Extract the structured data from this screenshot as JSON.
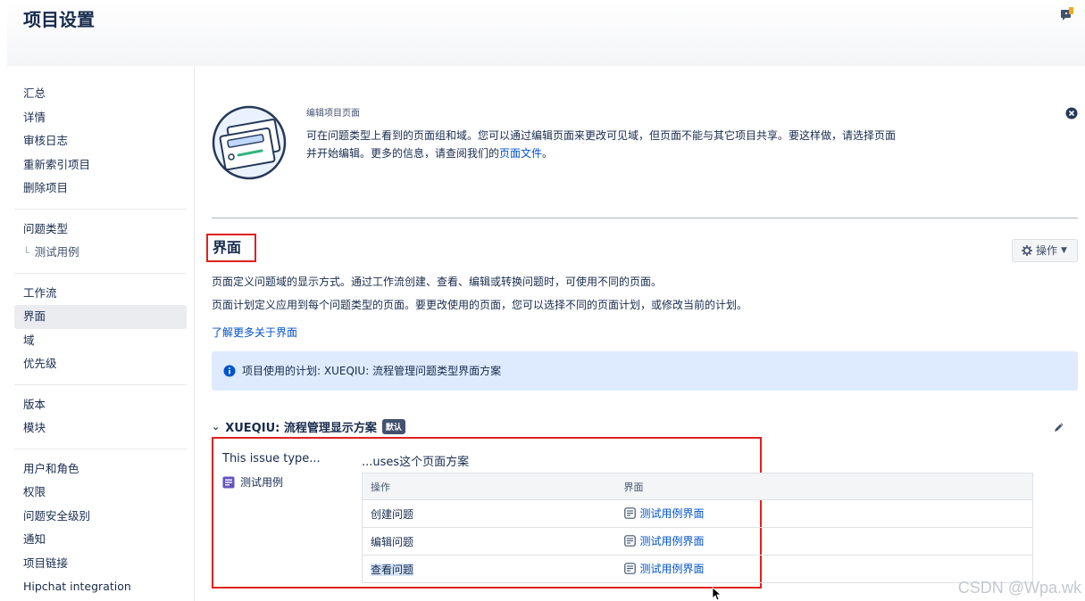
{
  "header": {
    "title": "项目设置"
  },
  "sidebar": {
    "groups": [
      {
        "items": [
          {
            "label": "汇总"
          },
          {
            "label": "详情"
          },
          {
            "label": "审核日志"
          },
          {
            "label": "重新索引项目"
          },
          {
            "label": "删除项目"
          }
        ]
      },
      {
        "items": [
          {
            "label": "问题类型"
          },
          {
            "label": "测试用例"
          }
        ]
      },
      {
        "items": [
          {
            "label": "工作流"
          },
          {
            "label": "界面"
          },
          {
            "label": "域"
          },
          {
            "label": "优先级"
          }
        ]
      },
      {
        "items": [
          {
            "label": "版本"
          },
          {
            "label": "模块"
          }
        ]
      },
      {
        "items": [
          {
            "label": "用户和角色"
          },
          {
            "label": "权限"
          },
          {
            "label": "问题安全级别"
          },
          {
            "label": "通知"
          },
          {
            "label": "项目链接"
          },
          {
            "label": "Hipchat integration"
          }
        ]
      }
    ]
  },
  "intro": {
    "small_title": "编辑项目页面",
    "text": "可在问题类型上看到的页面组和域。您可以通过编辑页面来更改可见域，但页面不能与其它项目共享。要这样做，请选择页面并开始编辑。更多的信息，请查阅我们的",
    "link": "页面文件",
    "suffix": "。"
  },
  "section": {
    "title": "界面",
    "ops_label": "操作",
    "desc1": "页面定义问题域的显示方式。通过工作流创建、查看、编辑或转换问题时，可使用不同的页面。",
    "desc2": "页面计划定义应用到每个问题类型的页面。要更改使用的页面，您可以选择不同的页面计划，或修改当前的计划。",
    "learn_more": "了解更多关于界面"
  },
  "banner": {
    "text": "项目使用的计划: XUEQIU: 流程管理问题类型界面方案"
  },
  "scheme": {
    "title": "XUEQIU: 流程管理显示方案",
    "badge": "默认",
    "left_title": "This issue type...",
    "right_title": "...uses这个页面方案",
    "issue_type": "测试用例",
    "table": {
      "headers": {
        "op": "操作",
        "screen": "界面"
      },
      "rows": [
        {
          "op": "创建问题",
          "screen": "测试用例界面"
        },
        {
          "op": "编辑问题",
          "screen": "测试用例界面"
        },
        {
          "op": "查看问题",
          "screen": "测试用例界面"
        }
      ]
    }
  },
  "watermark": "CSDN @Wpa.wk",
  "colors": {
    "link": "#0052cc",
    "highlight_box": "#e02020",
    "banner_bg": "#deebff",
    "badge_bg": "#42526e"
  }
}
